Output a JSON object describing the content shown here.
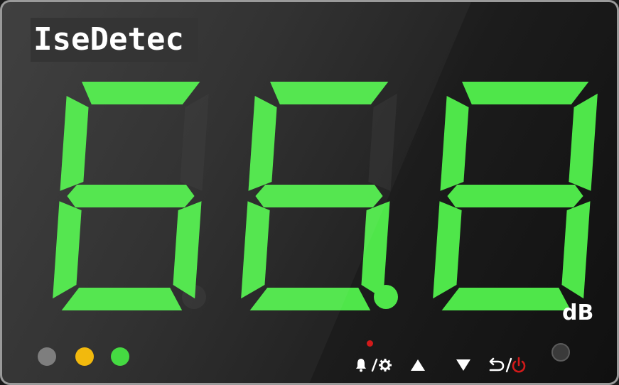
{
  "brand": {
    "name": "IseDetec"
  },
  "display": {
    "reading": "66.8",
    "unit": "dB",
    "segment_color": "#4fe64a",
    "decimal_lit": true
  },
  "status_leds": [
    {
      "name": "gray",
      "color": "#7a7a7a"
    },
    {
      "name": "yellow",
      "color": "#f2b705"
    },
    {
      "name": "green",
      "color": "#3fd93c"
    }
  ],
  "controls": {
    "alarm_settings_icon": "bell-gear-icon",
    "up_icon": "triangle-up-icon",
    "down_icon": "triangle-down-icon",
    "back_power_icon": "back-power-icon",
    "indicator_color": "#d21a1a"
  }
}
